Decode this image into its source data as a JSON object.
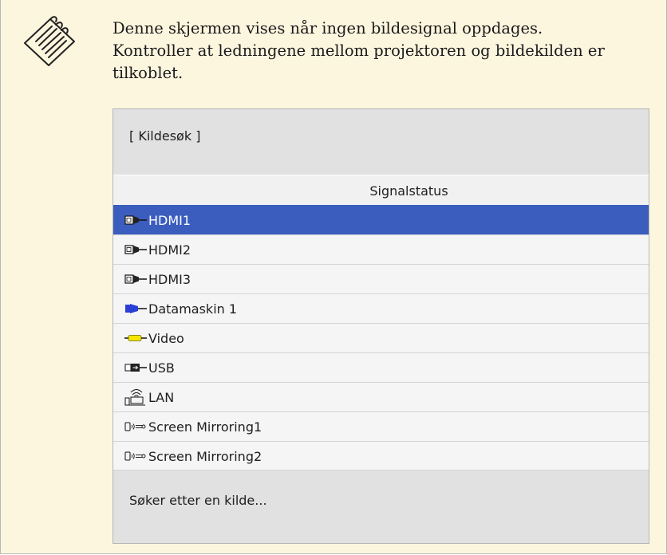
{
  "note": {
    "icon": "note-pencil-icon",
    "lines": [
      "Denne skjermen vises når ingen bildesignal oppdages.",
      "Kontroller at ledningene mellom projektoren og bildekilden er",
      "tilkoblet."
    ]
  },
  "panel": {
    "title": "[ Kildesøk ]",
    "signal_header": "Signalstatus",
    "status": "Søker etter en kilde...",
    "selected_color": "#3b5dbe",
    "sources": [
      {
        "label": "HDMI1",
        "icon": "hdmi-cable-icon",
        "selected": true
      },
      {
        "label": "HDMI2",
        "icon": "hdmi-cable-icon",
        "selected": false
      },
      {
        "label": "HDMI3",
        "icon": "hdmi-cable-icon",
        "selected": false
      },
      {
        "label": "Datamaskin 1",
        "icon": "vga-cable-icon",
        "selected": false
      },
      {
        "label": "Video",
        "icon": "composite-video-cable-icon",
        "selected": false
      },
      {
        "label": "USB",
        "icon": "usb-cable-icon",
        "selected": false
      },
      {
        "label": " LAN",
        "icon": "wireless-lan-icon",
        "selected": false
      },
      {
        "label": "Screen Mirroring1",
        "icon": "screen-mirroring-icon",
        "selected": false
      },
      {
        "label": "Screen Mirroring2",
        "icon": "screen-mirroring-icon",
        "selected": false
      }
    ]
  }
}
